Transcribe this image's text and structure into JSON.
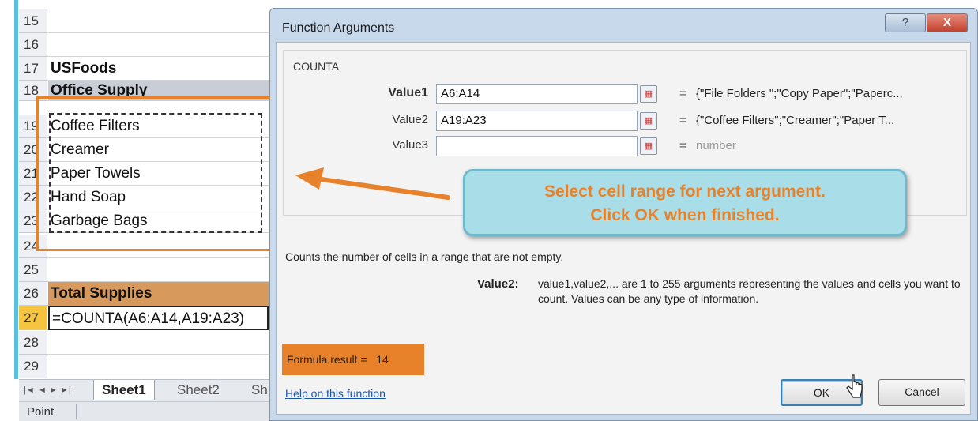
{
  "sheet": {
    "rows": [
      {
        "num": "15",
        "text": ""
      },
      {
        "num": "16",
        "text": ""
      },
      {
        "num": "17",
        "text": "USFoods"
      },
      {
        "num": "18",
        "text": "Office Supply"
      },
      {
        "num": "19",
        "text": "Coffee Filters"
      },
      {
        "num": "20",
        "text": "Creamer"
      },
      {
        "num": "21",
        "text": "Paper Towels"
      },
      {
        "num": "22",
        "text": "Hand Soap"
      },
      {
        "num": "23",
        "text": "Garbage Bags"
      },
      {
        "num": "24",
        "text": ""
      },
      {
        "num": "25",
        "text": ""
      },
      {
        "num": "26",
        "text": "Total Supplies"
      },
      {
        "num": "27",
        "text": "=COUNTA(A6:A14,A19:A23)"
      },
      {
        "num": "28",
        "text": ""
      },
      {
        "num": "29",
        "text": ""
      }
    ],
    "tabs": [
      "Sheet1",
      "Sheet2",
      "Sh"
    ],
    "nav_glyphs": [
      "|◄",
      "◄",
      "►",
      "►|"
    ],
    "status": "Point"
  },
  "dialog": {
    "title": "Function Arguments",
    "help_glyph": "?",
    "close_glyph": "X",
    "function_name": "COUNTA",
    "args": [
      {
        "label": "Value1",
        "value": "A6:A14",
        "result": "{\"File Folders \";\"Copy Paper\";\"Paperc..."
      },
      {
        "label": "Value2",
        "value": "A19:A23",
        "result": "{\"Coffee Filters\";\"Creamer\";\"Paper T..."
      },
      {
        "label": "Value3",
        "value": "",
        "result": "number"
      }
    ],
    "equals": "=",
    "description": "Counts the number of cells in a range that are not empty.",
    "arg_desc_label": "Value2:",
    "arg_desc_text": "value1,value2,... are 1 to 255 arguments representing the values and cells you want to count. Values can be any type of information.",
    "formula_result_label": "Formula result =",
    "formula_result_value": "14",
    "help_link": "Help on this function",
    "ok": "OK",
    "cancel": "Cancel"
  },
  "callout": {
    "line1": "Select cell range for next argument.",
    "line2": "Click OK when finished."
  },
  "colors": {
    "accent_orange": "#e8822a",
    "callout_bg": "#a9dde8",
    "dialog_frame": "#c8d9ec"
  },
  "icons": [
    "range-selector-icon",
    "left-arrow-icon",
    "mouse-pointer-icon"
  ]
}
